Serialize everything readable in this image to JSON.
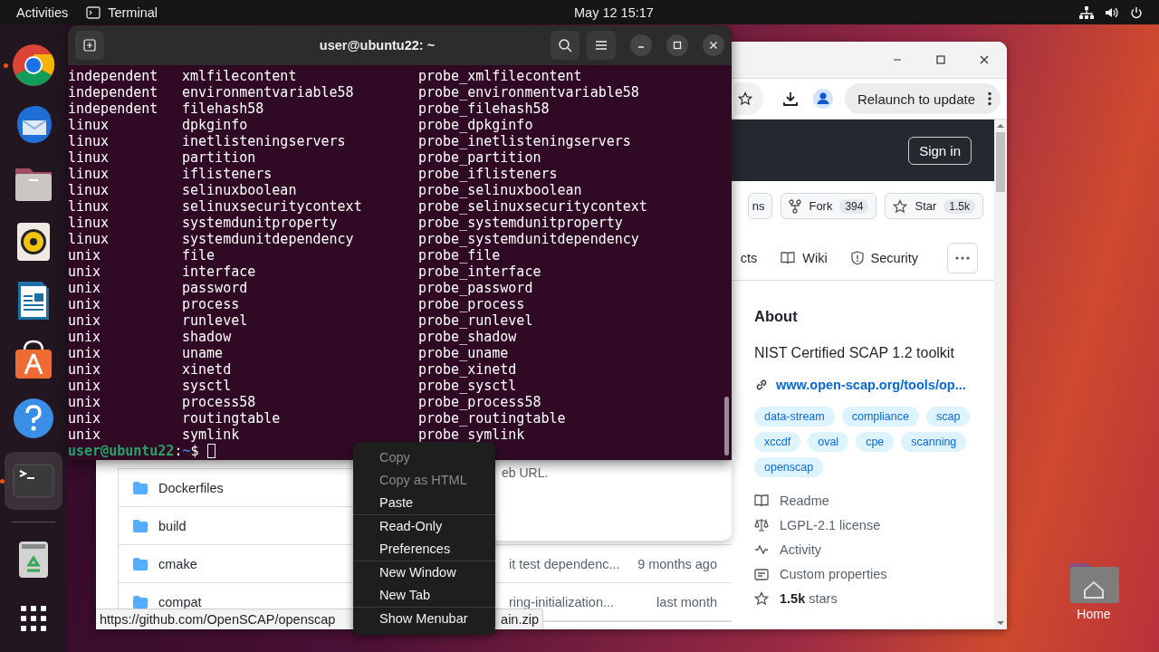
{
  "top_bar": {
    "activities": "Activities",
    "app": "Terminal",
    "clock": "May 12  15:17"
  },
  "dock": [
    {
      "kind": "chrome",
      "running": true,
      "selected": false
    },
    {
      "kind": "thunderbird",
      "running": false,
      "selected": false
    },
    {
      "kind": "files",
      "running": false,
      "selected": false
    },
    {
      "kind": "rhythmbox",
      "running": false,
      "selected": false
    },
    {
      "kind": "writer",
      "running": false,
      "selected": false
    },
    {
      "kind": "appcenter",
      "running": false,
      "selected": false
    },
    {
      "kind": "help",
      "running": false,
      "selected": false
    },
    {
      "kind": "terminal",
      "running": true,
      "selected": true
    },
    {
      "kind": "trash",
      "running": false,
      "selected": false
    },
    {
      "kind": "apps",
      "running": false,
      "selected": false
    }
  ],
  "terminal": {
    "title": "user@ubuntu22: ~",
    "rows": [
      [
        "independent",
        "xmlfilecontent",
        "probe_xmlfilecontent"
      ],
      [
        "independent",
        "environmentvariable58",
        "probe_environmentvariable58"
      ],
      [
        "independent",
        "filehash58",
        "probe_filehash58"
      ],
      [
        "linux",
        "dpkginfo",
        "probe_dpkginfo"
      ],
      [
        "linux",
        "inetlisteningservers",
        "probe_inetlisteningservers"
      ],
      [
        "linux",
        "partition",
        "probe_partition"
      ],
      [
        "linux",
        "iflisteners",
        "probe_iflisteners"
      ],
      [
        "linux",
        "selinuxboolean",
        "probe_selinuxboolean"
      ],
      [
        "linux",
        "selinuxsecuritycontext",
        "probe_selinuxsecuritycontext"
      ],
      [
        "linux",
        "systemdunitproperty",
        "probe_systemdunitproperty"
      ],
      [
        "linux",
        "systemdunitdependency",
        "probe_systemdunitdependency"
      ],
      [
        "unix",
        "file",
        "probe_file"
      ],
      [
        "unix",
        "interface",
        "probe_interface"
      ],
      [
        "unix",
        "password",
        "probe_password"
      ],
      [
        "unix",
        "process",
        "probe_process"
      ],
      [
        "unix",
        "runlevel",
        "probe_runlevel"
      ],
      [
        "unix",
        "shadow",
        "probe_shadow"
      ],
      [
        "unix",
        "uname",
        "probe_uname"
      ],
      [
        "unix",
        "xinetd",
        "probe_xinetd"
      ],
      [
        "unix",
        "sysctl",
        "probe_sysctl"
      ],
      [
        "unix",
        "process58",
        "probe_process58"
      ],
      [
        "unix",
        "routingtable",
        "probe_routingtable"
      ],
      [
        "unix",
        "symlink",
        "probe_symlink"
      ]
    ],
    "prompt": {
      "user": "user@ubuntu22",
      "separator": ":",
      "path": "~",
      "symbol": "$"
    }
  },
  "browser": {
    "relaunch": "Relaunch to update",
    "sign_in": "Sign in",
    "repo_buttons": [
      {
        "kind": "plain",
        "label": "ns"
      },
      {
        "kind": "fork",
        "label": "Fork",
        "count": "394"
      },
      {
        "kind": "star",
        "label": "Star",
        "count": "1.5k"
      }
    ],
    "nav": [
      {
        "kind": "plain",
        "label": "cts"
      },
      {
        "kind": "wiki",
        "label": "Wiki"
      },
      {
        "kind": "security",
        "label": "Security"
      }
    ],
    "clone_popup": {
      "text": "eb URL."
    },
    "files": [
      {
        "name": "Dockerfiles"
      },
      {
        "name": "build"
      },
      {
        "name": "cmake",
        "message": "it test dependenc...",
        "time": "9 months ago"
      },
      {
        "name": "compat",
        "message": "ring-initialization...",
        "time": "last month"
      }
    ],
    "about": {
      "heading": "About",
      "description": "NIST Certified SCAP 1.2 toolkit",
      "link": "www.open-scap.org/tools/op...",
      "topics": [
        "data-stream",
        "compliance",
        "scap",
        "xccdf",
        "oval",
        "cpe",
        "scanning",
        "openscap"
      ],
      "facts": [
        {
          "kind": "readme",
          "text": "Readme"
        },
        {
          "kind": "license",
          "text": "LGPL-2.1 license"
        },
        {
          "kind": "activity",
          "text": "Activity"
        },
        {
          "kind": "properties",
          "text": "Custom properties"
        },
        {
          "kind": "stars",
          "text": "**1.5k** stars"
        }
      ]
    },
    "status": [
      "https://github.com/OpenSCAP/openscap",
      "ain.zip"
    ]
  },
  "context_menu": [
    {
      "label": "Copy",
      "disabled": true,
      "separator_after": false
    },
    {
      "label": "Copy as HTML",
      "disabled": true,
      "separator_after": false
    },
    {
      "label": "Paste",
      "disabled": false,
      "separator_after": true
    },
    {
      "label": "Read-Only",
      "disabled": false,
      "separator_after": false
    },
    {
      "label": "Preferences",
      "disabled": false,
      "separator_after": true
    },
    {
      "label": "New Window",
      "disabled": false,
      "separator_after": false
    },
    {
      "label": "New Tab",
      "disabled": false,
      "separator_after": true
    },
    {
      "label": "Show Menubar",
      "disabled": false,
      "separator_after": false
    }
  ],
  "desktop_icons": [
    {
      "label": "Home"
    }
  ]
}
